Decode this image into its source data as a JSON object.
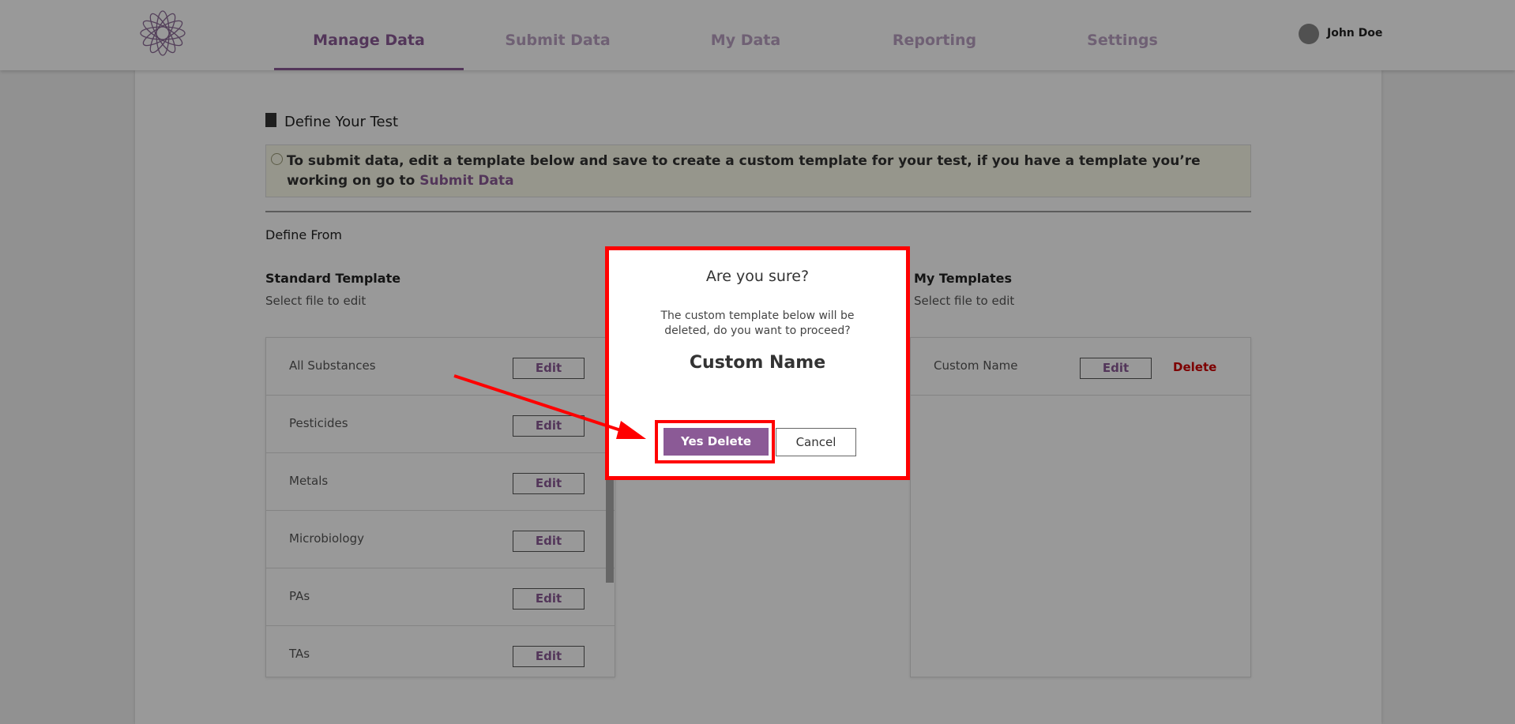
{
  "nav": {
    "items": [
      {
        "label": "Manage Data",
        "active": true
      },
      {
        "label": "Submit Data"
      },
      {
        "label": "My Data"
      },
      {
        "label": "Reporting"
      },
      {
        "label": "Settings"
      }
    ],
    "user": "John Doe"
  },
  "page": {
    "title": "Define Your Test",
    "alert_text": "To submit data, edit a template below and save to create a custom template for your test, if you have a template you’re working on go to ",
    "alert_link": "Submit Data",
    "define_from": "Define From",
    "standard": {
      "title": "Standard Template",
      "subtitle": "Select file to edit",
      "items": [
        "All Substances",
        "Pesticides",
        "Metals",
        "Microbiology",
        "PAs",
        "TAs"
      ]
    },
    "mine": {
      "title": "My Templates",
      "subtitle": "Select file to edit",
      "items": [
        {
          "name": "Custom Name",
          "delete": "Delete"
        }
      ]
    },
    "edit_label": "Edit"
  },
  "dialog": {
    "title": "Are you sure?",
    "message": "The custom template below will be deleted, do you want to proceed?",
    "name": "Custom Name",
    "confirm": "Yes Delete",
    "cancel": "Cancel"
  },
  "colors": {
    "brand": "#8b5a96",
    "danger": "#d00000",
    "annotation": "#ff0000"
  }
}
